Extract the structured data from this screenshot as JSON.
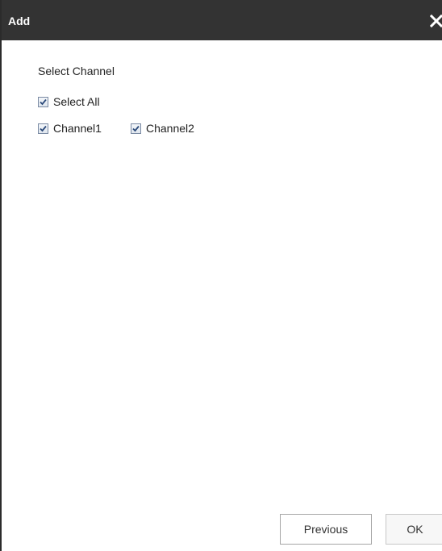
{
  "dialog": {
    "title": "Add",
    "close_icon": "close-icon"
  },
  "channel_selection": {
    "label": "Select Channel",
    "select_all": {
      "label": "Select All",
      "checked": true
    },
    "channels": [
      {
        "label": "Channel1",
        "checked": true
      },
      {
        "label": "Channel2",
        "checked": true
      }
    ]
  },
  "footer": {
    "previous_label": "Previous",
    "ok_label": "OK"
  }
}
